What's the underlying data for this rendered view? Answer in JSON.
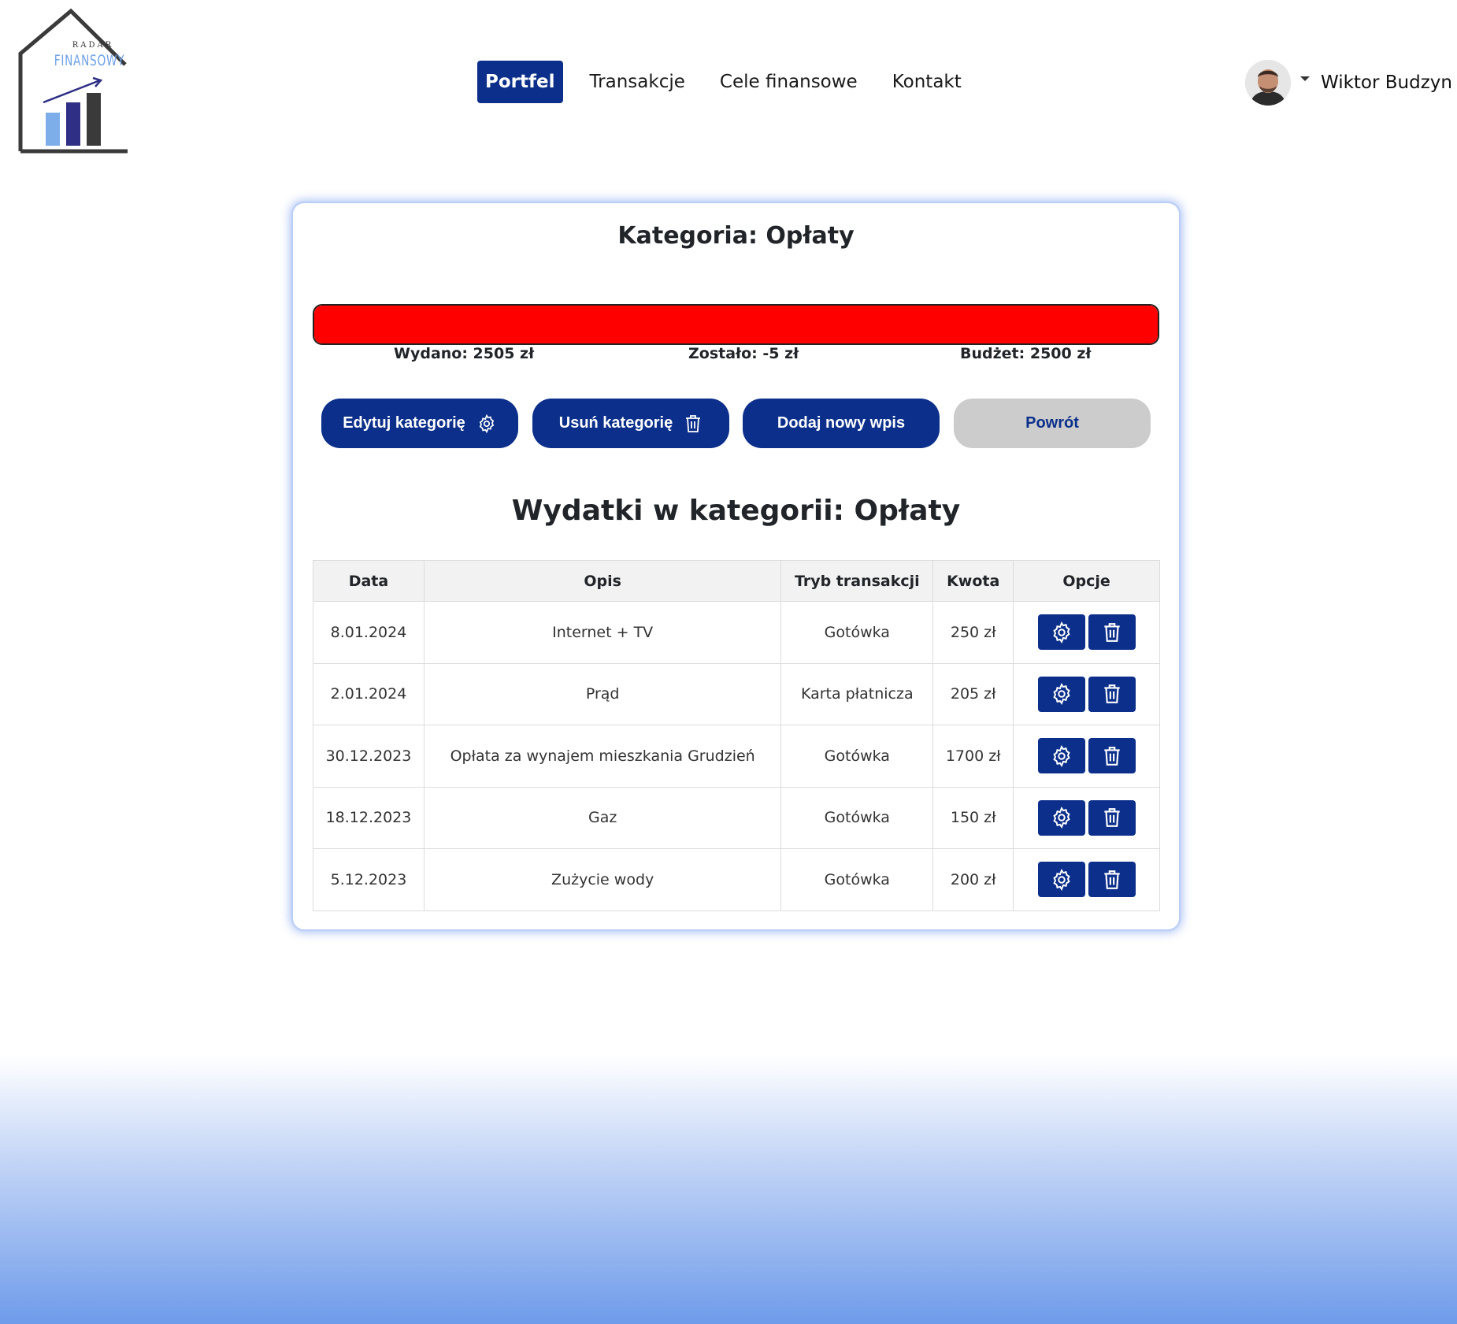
{
  "logo": {
    "top_text": "RADAR",
    "main_text": "FINANSOWY"
  },
  "nav": {
    "items": [
      {
        "label": "Portfel",
        "active": true
      },
      {
        "label": "Transakcje",
        "active": false
      },
      {
        "label": "Cele finansowe",
        "active": false
      },
      {
        "label": "Kontakt",
        "active": false
      }
    ]
  },
  "user": {
    "name": "Wiktor Budzyn"
  },
  "category": {
    "title": "Kategoria: Opłaty",
    "progress_percent": 100,
    "progress_color": "#ff0000",
    "spent": "Wydano: 2505 zł",
    "remaining": "Zostało: -5 zł",
    "budget": "Budżet: 2500 zł"
  },
  "actions": {
    "edit": "Edytuj kategorię",
    "delete": "Usuń kategorię",
    "add": "Dodaj nowy wpis",
    "back": "Powrót"
  },
  "expenses": {
    "title": "Wydatki w kategorii: Opłaty",
    "columns": [
      "Data",
      "Opis",
      "Tryb transakcji",
      "Kwota",
      "Opcje"
    ],
    "rows": [
      {
        "date": "8.01.2024",
        "desc": "Internet + TV",
        "mode": "Gotówka",
        "amount": "250 zł"
      },
      {
        "date": "2.01.2024",
        "desc": "Prąd",
        "mode": "Karta płatnicza",
        "amount": "205 zł"
      },
      {
        "date": "30.12.2023",
        "desc": "Opłata za wynajem mieszkania Grudzień",
        "mode": "Gotówka",
        "amount": "1700 zł"
      },
      {
        "date": "18.12.2023",
        "desc": "Gaz",
        "mode": "Gotówka",
        "amount": "150 zł"
      },
      {
        "date": "5.12.2023",
        "desc": "Zużycie wody",
        "mode": "Gotówka",
        "amount": "200 zł"
      }
    ]
  },
  "colors": {
    "primary": "#0b2f8a",
    "secondary": "#cccccc",
    "danger": "#ff0000"
  }
}
